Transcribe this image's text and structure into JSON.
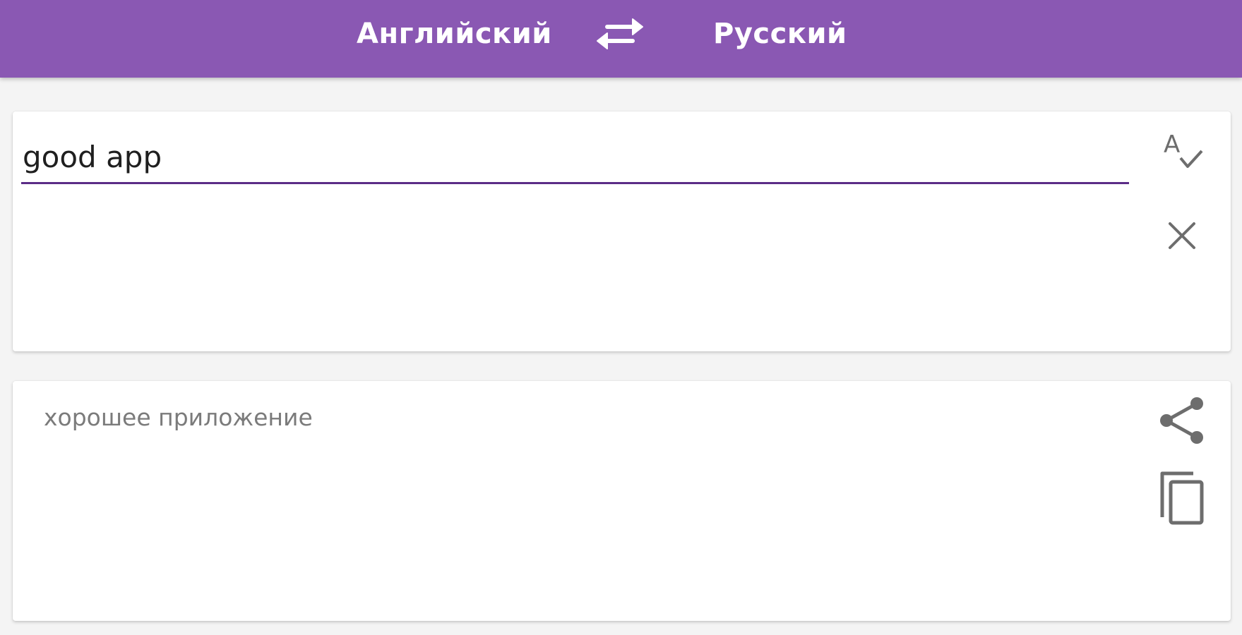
{
  "header": {
    "source_language": "Английский",
    "target_language": "Русский",
    "swap_icon": "swap-arrows-icon",
    "background_color": "#8a58b3"
  },
  "input_card": {
    "text_value": "good app",
    "spellcheck_icon": "spellcheck-icon",
    "clear_icon": "close-icon",
    "underline_color": "#5b2c87"
  },
  "output_card": {
    "translation": "хорошее приложение",
    "share_icon": "share-icon",
    "copy_icon": "copy-icon"
  }
}
